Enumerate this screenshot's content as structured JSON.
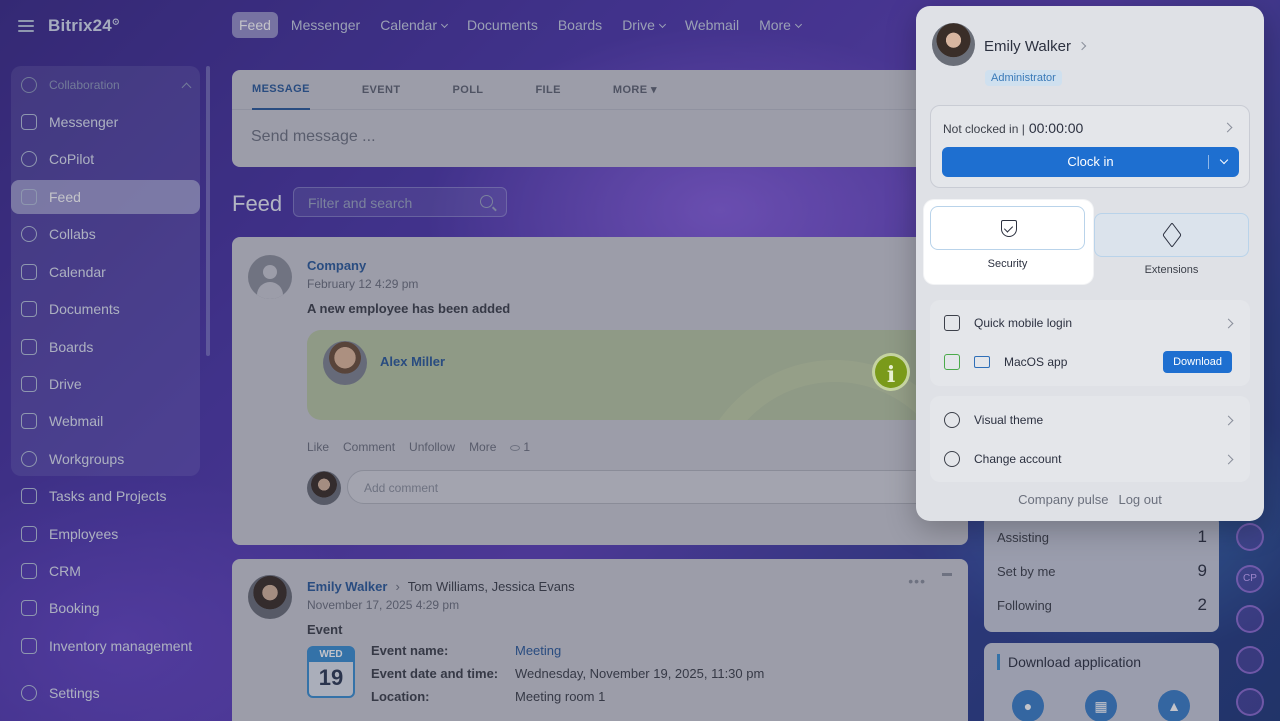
{
  "app": {
    "logo": "Bitrix24",
    "logo_mark": "⊙"
  },
  "sidebar": {
    "group_label": "Collaboration",
    "items": [
      {
        "label": "Messenger"
      },
      {
        "label": "CoPilot"
      },
      {
        "label": "Feed"
      },
      {
        "label": "Collabs"
      },
      {
        "label": "Calendar"
      },
      {
        "label": "Documents"
      },
      {
        "label": "Boards"
      },
      {
        "label": "Drive"
      },
      {
        "label": "Webmail"
      },
      {
        "label": "Workgroups"
      },
      {
        "label": "Tasks and Projects"
      },
      {
        "label": "Employees"
      },
      {
        "label": "CRM"
      },
      {
        "label": "Booking"
      },
      {
        "label": "Inventory management"
      }
    ],
    "settings_label": "Settings"
  },
  "topnav": {
    "tabs": [
      {
        "label": "Feed"
      },
      {
        "label": "Messenger"
      },
      {
        "label": "Calendar"
      },
      {
        "label": "Documents"
      },
      {
        "label": "Boards"
      },
      {
        "label": "Drive"
      },
      {
        "label": "Webmail"
      },
      {
        "label": "More"
      }
    ]
  },
  "composer": {
    "tabs": [
      "MESSAGE",
      "EVENT",
      "POLL",
      "FILE",
      "MORE"
    ],
    "placeholder": "Send message ..."
  },
  "feed": {
    "title": "Feed",
    "search_placeholder": "Filter and search"
  },
  "post1": {
    "author": "Company",
    "date": "February 12 4:29 pm",
    "text": "A new employee has been added",
    "employee_name": "Alex Miller",
    "info_glyph": "i",
    "actions": [
      "Like",
      "Comment",
      "Unfollow",
      "More"
    ],
    "views": "1",
    "comment_placeholder": "Add comment"
  },
  "post2": {
    "author": "Emily Walker",
    "recipients": "Tom Williams, Jessica Evans",
    "date": "November 17, 2025 4:29 pm",
    "type_label": "Event",
    "cal_weekday": "WED",
    "cal_day": "19",
    "fields": [
      {
        "key": "Event name:",
        "value": "Meeting",
        "link": true
      },
      {
        "key": "Event date and time:",
        "value": "Wednesday, November 19, 2025, 11:30 pm",
        "link": false
      },
      {
        "key": "Location:",
        "value": "Meeting room 1",
        "link": false
      }
    ]
  },
  "tasks": {
    "rows": [
      {
        "label": "Assisting",
        "value": "1"
      },
      {
        "label": "Set by me",
        "value": "9"
      },
      {
        "label": "Following",
        "value": "2"
      }
    ]
  },
  "download_app": {
    "title": "Download application"
  },
  "profile": {
    "name": "Emily Walker",
    "role": "Administrator",
    "clock_status": "Not clocked in |",
    "clock_time": "00:00:00",
    "clock_button": "Clock in",
    "security_label": "Security",
    "extensions_label": "Extensions",
    "quick_login": "Quick mobile login",
    "macos_app": "MacOS app",
    "download_button": "Download",
    "visual_theme": "Visual theme",
    "change_account": "Change account",
    "company_pulse": "Company pulse",
    "logout": "Log out"
  },
  "colors": {
    "accent": "#1e6fd0",
    "link": "#2a5a9a",
    "info_green": "#7a9a1a"
  }
}
